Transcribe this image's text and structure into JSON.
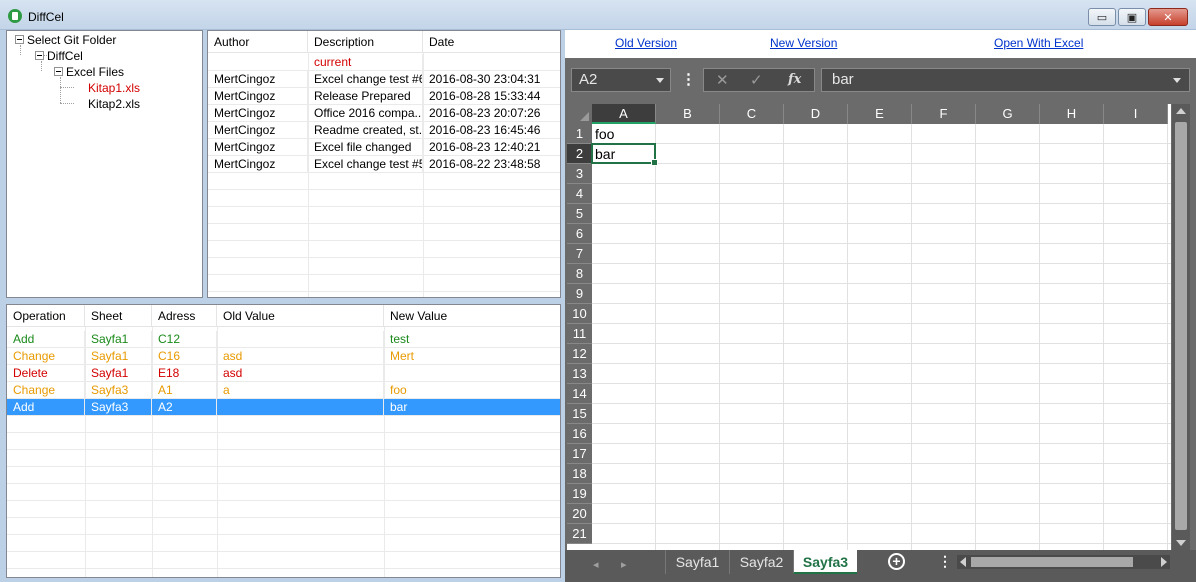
{
  "window": {
    "title": "DiffCel",
    "minimize": "▭",
    "maximize": "▣",
    "close": "✕"
  },
  "tree": {
    "root": "Select Git Folder",
    "repo": "DiffCel",
    "folder": "Excel Files",
    "files": [
      "Kitap1.xls",
      "Kitap2.xls"
    ]
  },
  "commits": {
    "headers": [
      "Author",
      "Description",
      "Date"
    ],
    "current_label": "current",
    "rows": [
      [
        "MertCingoz",
        "Excel change test #6",
        "2016-08-30 23:04:31"
      ],
      [
        "MertCingoz",
        "Release Prepared",
        "2016-08-28 15:33:44"
      ],
      [
        "MertCingoz",
        "Office 2016 compa...",
        "2016-08-23 20:07:26"
      ],
      [
        "MertCingoz",
        "Readme created, st...",
        "2016-08-23 16:45:46"
      ],
      [
        "MertCingoz",
        "Excel file changed",
        "2016-08-23 12:40:21"
      ],
      [
        "MertCingoz",
        "Excel change test #5",
        "2016-08-22 23:48:58"
      ]
    ]
  },
  "changes": {
    "headers": [
      "Operation",
      "Sheet",
      "Adress",
      "Old Value",
      "New Value"
    ],
    "rows": [
      {
        "type": "add",
        "cells": [
          "Add",
          "Sayfa1",
          "C12",
          "",
          "test"
        ]
      },
      {
        "type": "change",
        "cells": [
          "Change",
          "Sayfa1",
          "C16",
          "asd",
          "Mert"
        ]
      },
      {
        "type": "delete",
        "cells": [
          "Delete",
          "Sayfa1",
          "E18",
          "asd",
          ""
        ]
      },
      {
        "type": "change",
        "cells": [
          "Change",
          "Sayfa3",
          "A1",
          "a",
          "foo"
        ]
      },
      {
        "type": "add",
        "selected": true,
        "cells": [
          "Add",
          "Sayfa3",
          "A2",
          "",
          "bar"
        ]
      }
    ]
  },
  "links": {
    "old": "Old Version",
    "new": "New Version",
    "excel": "Open With Excel"
  },
  "excel": {
    "name_box": "A2",
    "menu_dots": "⋮",
    "cancel": "✕",
    "enter": "✓",
    "fx": "fx",
    "formula": "bar",
    "columns": [
      "A",
      "B",
      "C",
      "D",
      "E",
      "F",
      "G",
      "H",
      "I"
    ],
    "rows": [
      "1",
      "2",
      "3",
      "4",
      "5",
      "6",
      "7",
      "8",
      "9",
      "10",
      "11",
      "12",
      "13",
      "14",
      "15",
      "16",
      "17",
      "18",
      "19",
      "20",
      "21"
    ],
    "cells": [
      {
        "ref": "A1",
        "value": "foo"
      },
      {
        "ref": "A2",
        "value": "bar"
      }
    ],
    "active_cell": "A2",
    "tabs": [
      "Sayfa1",
      "Sayfa2",
      "Sayfa3"
    ],
    "active_tab": "Sayfa3",
    "tab_prev": "◂",
    "tab_next": "▸",
    "add_sheet": "+",
    "tab_menu": "⋮"
  },
  "colors": {
    "add": "#1a8a1a",
    "change": "#e89a00",
    "delete": "#d30000",
    "selection": "#3399ff",
    "excel_green": "#217346"
  }
}
